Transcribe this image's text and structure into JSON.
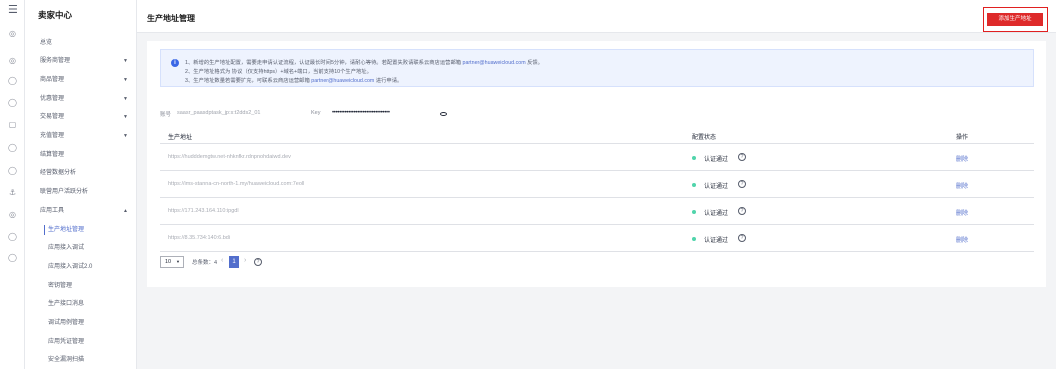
{
  "rail": {
    "icons": [
      "menu-icon",
      "home-icon",
      "service-icon",
      "product-icon",
      "promo-icon",
      "trade-icon",
      "recharge-icon",
      "settlement-icon",
      "analytics-icon",
      "user-analytics-icon",
      "tools-icon"
    ]
  },
  "sidebar": {
    "title": "卖家中心",
    "items": [
      {
        "label": "总览",
        "expandable": false
      },
      {
        "label": "服务商管理",
        "expandable": true
      },
      {
        "label": "商品管理",
        "expandable": true
      },
      {
        "label": "优惠管理",
        "expandable": true
      },
      {
        "label": "交易管理",
        "expandable": true
      },
      {
        "label": "充值管理",
        "expandable": true
      },
      {
        "label": "结算管理",
        "expandable": false
      },
      {
        "label": "经营数据分析",
        "expandable": false
      },
      {
        "label": "联营用户活跃分析",
        "expandable": false
      },
      {
        "label": "应用工具",
        "expandable": true,
        "expanded": true
      }
    ],
    "subitems": [
      "生产地址管理",
      "应用接入调试",
      "应用接入调试2.0",
      "密钥管理",
      "生产接口消息",
      "调试用例管理",
      "应用凭证管理",
      "安全漏洞扫描"
    ],
    "active_sub": "生产地址管理"
  },
  "header": {
    "title": "生产地址管理",
    "add_button": "添加生产地址"
  },
  "notice": {
    "line1_text": "1、新增的生产地址配置，需要走申请认证流程，认证最长时间5分钟，请耐心等待。若配置失败请联系云商店运营邮箱 ",
    "line1_link": "partner@huaweicloud.com",
    "line1_tail": " 反馈。",
    "line2": "2、生产地址格式为 协议（仅支持https）+域名+端口，当前支持10个生产地址。",
    "line3_text": "3、生产地址数量若需要扩充，可联系云商店运营邮箱 ",
    "line3_link": "partner@huaweicloud.com",
    "line3_tail": " 进行申请。"
  },
  "credentials": {
    "account_label": "账号",
    "account_value": "saasr_paasdptask_jp:s:t2dds2_01",
    "key_label": "Key",
    "key_value": "••••••••••••••••••••••••••••••••"
  },
  "table": {
    "headers": {
      "address": "生产地址",
      "status": "配置状态",
      "ops": "操作"
    },
    "rows": [
      {
        "address": "https://hudddemgtw.net-nhknfkr.rdnpnohdaiwd.dev",
        "status": "认证通过",
        "op": "删除"
      },
      {
        "address": "https://ims-stanna-cn-north-1.my/huaweicloud.com:7eoll",
        "status": "认证通过",
        "op": "删除"
      },
      {
        "address": "https://171.243.164.110:ipgdl",
        "status": "认证通过",
        "op": "删除"
      },
      {
        "address": "https://8.35.734:140:6.bdi",
        "status": "认证通过",
        "op": "删除"
      }
    ]
  },
  "pager": {
    "size": "10",
    "total": "总条数：4",
    "current": "1"
  },
  "colors": {
    "accent": "#526ecc",
    "danger": "#de2a2a",
    "success": "#50d4ab"
  }
}
